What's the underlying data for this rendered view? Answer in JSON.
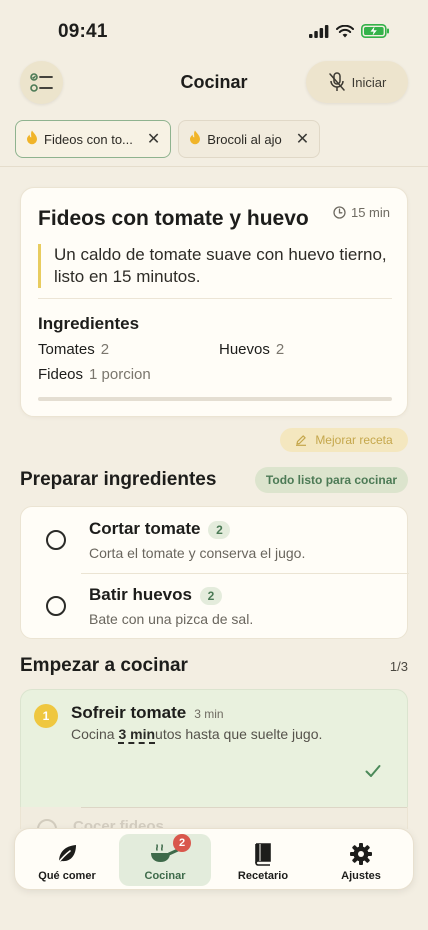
{
  "status": {
    "time": "09:41"
  },
  "header": {
    "title": "Cocinar",
    "start_label": "Iniciar"
  },
  "tabs": [
    {
      "label": "Fideos con to...",
      "active": true
    },
    {
      "label": "Brocoli al ajo",
      "active": false
    }
  ],
  "recipe": {
    "title": "Fideos con tomate y huevo",
    "time": "15 min",
    "description": "Un caldo de tomate suave con huevo tierno, listo en 15 minutos.",
    "ingredients_title": "Ingredientes",
    "ingredients": [
      {
        "name": "Tomates",
        "qty": "2"
      },
      {
        "name": "Huevos",
        "qty": "2"
      },
      {
        "name": "Fideos",
        "qty": "1 porcion"
      }
    ]
  },
  "improve_label": "Mejorar receta",
  "prep": {
    "title": "Preparar ingredientes",
    "ready_label": "Todo listo para cocinar",
    "items": [
      {
        "name": "Cortar tomate",
        "count": "2",
        "desc": "Corta el tomate y conserva el jugo."
      },
      {
        "name": "Batir huevos",
        "count": "2",
        "desc": "Bate con una pizca de sal."
      }
    ]
  },
  "cook": {
    "title": "Empezar a cocinar",
    "progress": "1/3",
    "steps": [
      {
        "num": "1",
        "name": "Sofreir tomate",
        "time": "3 min",
        "desc_before": "Cocina ",
        "desc_highlight": "3 min",
        "desc_after": "utos hasta que suelte jugo."
      },
      {
        "name": "Cocer fideos"
      }
    ]
  },
  "tabbar": {
    "items": [
      {
        "label": "Qué comer"
      },
      {
        "label": "Cocinar",
        "badge": "2"
      },
      {
        "label": "Recetario"
      },
      {
        "label": "Ajustes"
      }
    ]
  }
}
